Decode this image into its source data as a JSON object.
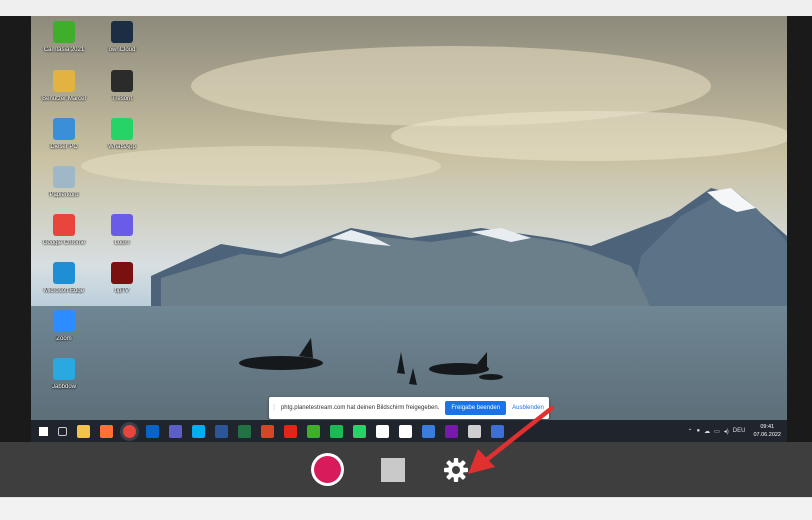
{
  "desktop": {
    "icons": [
      {
        "label": "Camtasia 2021",
        "icon": "camtasia-icon",
        "color": "#3fae2a"
      },
      {
        "label": "ownCloud",
        "icon": "owncloud-icon",
        "color": "#1d2d44"
      },
      {
        "label": "Benutzer Marcel",
        "icon": "user-folder-icon",
        "color": "#e3b341"
      },
      {
        "label": "Tresorit",
        "icon": "tresorit-icon",
        "color": "#2b2b2b"
      },
      {
        "label": "Dieser PC",
        "icon": "this-pc-icon",
        "color": "#3a8fd6"
      },
      {
        "label": "WhatsApp",
        "icon": "whatsapp-icon",
        "color": "#25d366"
      },
      {
        "label": "Papierkorb",
        "icon": "recycle-bin-icon",
        "color": "#9fb8c8"
      },
      {
        "label": "Google Chrome",
        "icon": "chrome-icon",
        "color": "#e8453c"
      },
      {
        "label": "Loom",
        "icon": "loom-icon",
        "color": "#6b5ce7"
      },
      {
        "label": "Microsoft Edge",
        "icon": "edge-icon",
        "color": "#1e8fd5"
      },
      {
        "label": "tipTV",
        "icon": "tiptv-icon",
        "color": "#7a1010"
      },
      {
        "label": "Zoom",
        "icon": "zoom-icon",
        "color": "#2d8cff"
      },
      {
        "label": "Jabbdow",
        "icon": "jabber-icon",
        "color": "#2aa8e0"
      }
    ]
  },
  "share_bar": {
    "grip": "⁞",
    "message": "phtg.planetestream.com hat deinen Bildschirm freigegeben.",
    "stop_label": "Freigabe beenden",
    "hide_label": "Ausblenden"
  },
  "taskbar": {
    "apps": [
      {
        "name": "start-icon",
        "color": "#ffffff"
      },
      {
        "name": "task-view-icon",
        "color": "#c8c8c8"
      },
      {
        "name": "file-explorer-icon",
        "color": "#f2c14e"
      },
      {
        "name": "firefox-icon",
        "color": "#ff7139"
      },
      {
        "name": "chrome-icon",
        "color": "#e8453c"
      },
      {
        "name": "outlook-icon",
        "color": "#0a64c8"
      },
      {
        "name": "teams-icon",
        "color": "#5b5fc7"
      },
      {
        "name": "skype-icon",
        "color": "#00aff0"
      },
      {
        "name": "word-icon",
        "color": "#2b579a"
      },
      {
        "name": "excel-icon",
        "color": "#217346"
      },
      {
        "name": "powerpoint-icon",
        "color": "#d24726"
      },
      {
        "name": "acrobat-icon",
        "color": "#e1251b"
      },
      {
        "name": "camtasia-icon",
        "color": "#3fae2a"
      },
      {
        "name": "spotify-icon",
        "color": "#1db954"
      },
      {
        "name": "whatsapp-icon",
        "color": "#25d366"
      },
      {
        "name": "app-icon",
        "color": "#ffffff"
      },
      {
        "name": "chat-icon",
        "color": "#ffffff"
      },
      {
        "name": "calendar-icon",
        "color": "#3b7ddd"
      },
      {
        "name": "onenote-icon",
        "color": "#7719aa"
      },
      {
        "name": "screen-recorder-icon",
        "color": "#cfcfcf"
      },
      {
        "name": "taskbar-app-icon",
        "color": "#3d6fd6"
      }
    ],
    "language": "DEU",
    "time": "09:41",
    "date": "07.06.2022"
  },
  "controls": {
    "record_color": "#d81b5a"
  }
}
